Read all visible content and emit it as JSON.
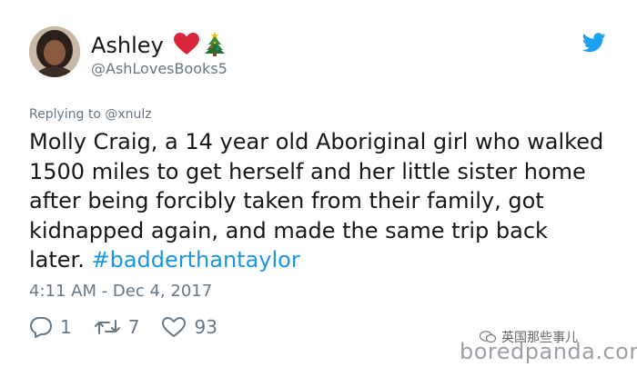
{
  "tweet": {
    "display_name": "Ashley",
    "handle": "@AshLovesBooks5",
    "name_emojis": [
      "heart-icon",
      "christmas-tree-icon"
    ],
    "reply_context": "Replying to @xnulz",
    "text_lines": [
      "Molly Craig, a 14 year old Aboriginal girl who walked",
      "1500 miles to get herself and her little sister home",
      "after being forcibly taken from their family, got",
      "kidnapped again, and made the same trip back"
    ],
    "last_line_text": "later. ",
    "hashtag": "#badderthantaylor",
    "timestamp": "4:11 AM - Dec 4, 2017",
    "actions": {
      "replies": "1",
      "retweets": "7",
      "likes": "93"
    }
  },
  "colors": {
    "text": "#14171a",
    "secondary": "#657786",
    "link": "#1b95e0",
    "twitter_blue": "#1da1f2",
    "heart_red": "#d9263b"
  },
  "watermark": {
    "wechat_text": "英国那些事儿",
    "site_text": "boredpanda.com"
  }
}
